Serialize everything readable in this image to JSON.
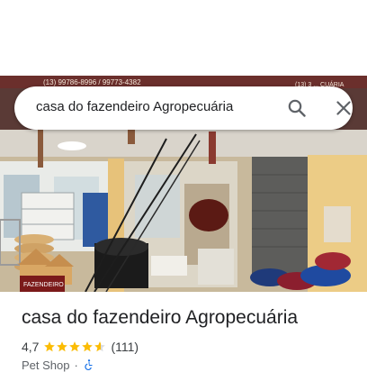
{
  "search": {
    "query": "casa do fazendeiro Agropecuária"
  },
  "banner": {
    "phone_left": "(13) 99786-8996 / 99773-4382",
    "phone_right": "(13) 3 ... CUÁRIA",
    "sign_text": "FAZENDEIRO"
  },
  "place": {
    "name": "casa do fazendeiro Agropecuária",
    "rating": "4,7",
    "stars": 4.5,
    "review_count": "(111)",
    "category": "Pet Shop",
    "separator": "·",
    "accessibility_icon": "wheelchair-icon"
  },
  "colors": {
    "star": "#fbbc04",
    "accessibility": "#1a73e8",
    "text_primary": "#202124",
    "text_secondary": "#5f6368"
  }
}
